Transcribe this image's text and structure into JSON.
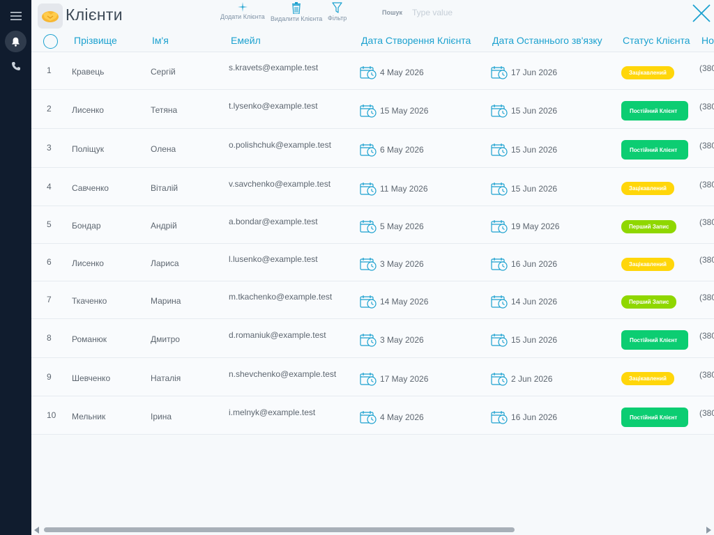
{
  "app": {
    "title": "Клієнти"
  },
  "toolbar": {
    "add_label": "Додати Клієнта",
    "delete_label": "Видалити Клієнта",
    "filter_label": "Фільтр",
    "search_label": "Пошук",
    "search_placeholder": "Type value",
    "search_value": ""
  },
  "columns": {
    "last_name": "Прізвище",
    "first_name": "Ім'я",
    "email": "Емейл",
    "created": "Дата Створення Клієнта",
    "last_contact": "Дата Останнього зв'язку",
    "status": "Статус Клієнта",
    "phone": "Но"
  },
  "colors": {
    "accent": "#1ba1cf",
    "sidebar": "#101c2e",
    "status_interested": "#ffd60a",
    "status_regular": "#0ccd72",
    "status_first": "#8fd700"
  },
  "icons": {
    "menu": "hamburger-icon",
    "bell": "bell-icon",
    "phone": "phone-icon",
    "logo": "handshake-icon",
    "add": "plus-icon",
    "delete": "trash-icon",
    "filter": "filter-icon",
    "close": "close-icon",
    "date": "calendar-clock-icon"
  },
  "rows": [
    {
      "num": "1",
      "last": "Кравець",
      "first": "Сергій",
      "email": "s.kravets@example.test",
      "created": "4 May 2026",
      "last_contact": "17 Jun 2026",
      "status": "Зацікавлений",
      "status_type": "yellow",
      "phone": "(380"
    },
    {
      "num": "2",
      "last": "Лисенко",
      "first": "Тетяна",
      "email": "t.lysenko@example.test",
      "created": "15 May 2026",
      "last_contact": "15 Jun 2026",
      "status": "Постійний Клієнт",
      "status_type": "green",
      "phone": "(380"
    },
    {
      "num": "3",
      "last": "Поліщук",
      "first": "Олена",
      "email": "o.polishchuk@example.test",
      "created": "6 May 2026",
      "last_contact": "15 Jun 2026",
      "status": "Постійний Клієнт",
      "status_type": "green",
      "phone": "(380"
    },
    {
      "num": "4",
      "last": "Савченко",
      "first": "Віталій",
      "email": "v.savchenko@example.test",
      "created": "11 May 2026",
      "last_contact": "15 Jun 2026",
      "status": "Зацікавлений",
      "status_type": "yellow",
      "phone": "(380"
    },
    {
      "num": "5",
      "last": "Бондар",
      "first": "Андрій",
      "email": "a.bondar@example.test",
      "created": "5 May 2026",
      "last_contact": "19 May 2026",
      "status": "Перший Запис",
      "status_type": "lime",
      "phone": "(380"
    },
    {
      "num": "6",
      "last": "Лисенко",
      "first": "Лариса",
      "email": "l.lusenko@example.test",
      "created": "3 May 2026",
      "last_contact": "16 Jun 2026",
      "status": "Зацікавлений",
      "status_type": "yellow",
      "phone": "(380"
    },
    {
      "num": "7",
      "last": "Ткаченко",
      "first": "Марина",
      "email": "m.tkachenko@example.test",
      "created": "14 May 2026",
      "last_contact": "14 Jun 2026",
      "status": "Перший Запис",
      "status_type": "lime",
      "phone": "(380"
    },
    {
      "num": "8",
      "last": "Романюк",
      "first": "Дмитро",
      "email": "d.romaniuk@example.test",
      "created": "3 May 2026",
      "last_contact": "15 Jun 2026",
      "status": "Постійний Клієнт",
      "status_type": "green",
      "phone": "(380"
    },
    {
      "num": "9",
      "last": "Шевченко",
      "first": "Наталія",
      "email": "n.shevchenko@example.test",
      "created": "17 May 2026",
      "last_contact": "2 Jun 2026",
      "status": "Зацікавлений",
      "status_type": "yellow",
      "phone": "(380"
    },
    {
      "num": "10",
      "last": "Мельник",
      "first": "Ірина",
      "email": "i.melnyk@example.test",
      "created": "4 May 2026",
      "last_contact": "16 Jun 2026",
      "status": "Постійний Клієнт",
      "status_type": "green",
      "phone": "(380"
    }
  ]
}
